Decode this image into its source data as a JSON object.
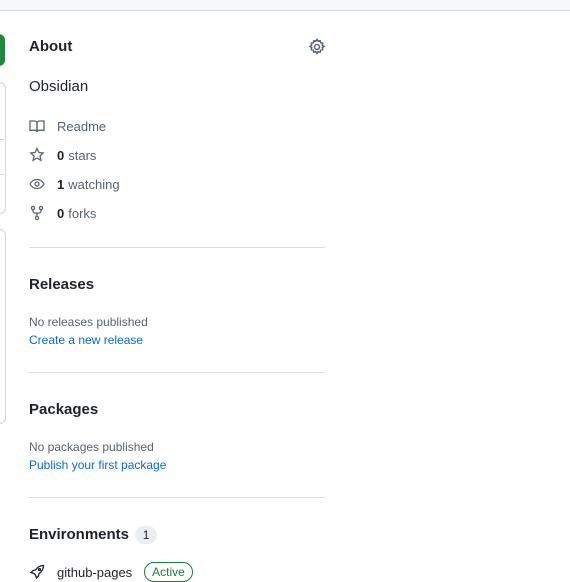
{
  "about": {
    "title": "About",
    "description": "Obsidian",
    "readme_label": "Readme",
    "stars_count": "0",
    "stars_label": "stars",
    "watching_count": "1",
    "watching_label": "watching",
    "forks_count": "0",
    "forks_label": "forks"
  },
  "releases": {
    "title": "Releases",
    "status": "No releases published",
    "create_link": "Create a new release"
  },
  "packages": {
    "title": "Packages",
    "status": "No packages published",
    "publish_link": "Publish your first package"
  },
  "environments": {
    "title": "Environments",
    "count": "1",
    "items": [
      {
        "name": "github-pages",
        "status": "Active"
      }
    ]
  },
  "colors": {
    "primary_green": "#1f883d",
    "link_blue": "#0969da",
    "muted_text": "#59636e",
    "active_badge": "#1a7f37"
  }
}
